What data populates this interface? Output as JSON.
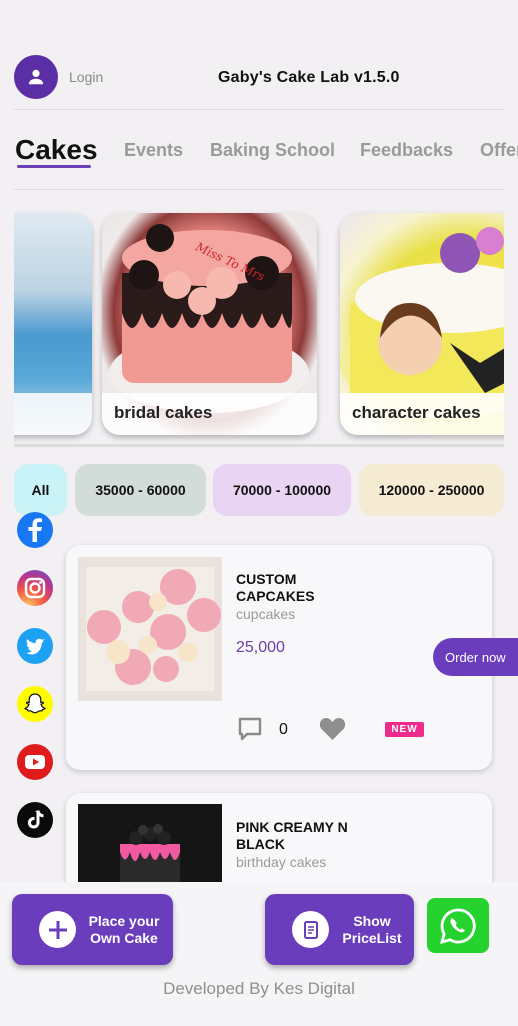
{
  "header": {
    "login_label": "Login",
    "app_title": "Gaby's Cake Lab v1.5.0"
  },
  "tabs": [
    {
      "label": "Cakes"
    },
    {
      "label": "Events"
    },
    {
      "label": "Baking School"
    },
    {
      "label": "Feedbacks"
    },
    {
      "label": "Offers"
    }
  ],
  "categories": [
    {
      "label": ""
    },
    {
      "label": "bridal cakes",
      "cake_text": "Miss To Mrs"
    },
    {
      "label": "character cakes"
    }
  ],
  "price_filters": [
    {
      "label": "All",
      "color": "#c9f3f6"
    },
    {
      "label": "35000 - 60000",
      "color": "#d2dcd8"
    },
    {
      "label": "70000 - 100000",
      "color": "#e9d4f3"
    },
    {
      "label": "120000 - 250000",
      "color": "#f4ebd2"
    }
  ],
  "social": [
    "facebook-icon",
    "instagram-icon",
    "twitter-icon",
    "snapchat-icon",
    "youtube-icon",
    "tiktok-icon"
  ],
  "products": [
    {
      "name": "CUSTOM CAPCAKES",
      "category": "cupcakes",
      "price": "25,000",
      "comments": "0",
      "badge": "NEW"
    },
    {
      "name": "PINK CREAMY N BLACK",
      "category": "birthday cakes"
    }
  ],
  "order_label": "Order now",
  "actions": {
    "place_order": "Place your Own Cake",
    "pricelist": "Show PriceList"
  },
  "footer": "Developed By Kes Digital",
  "colors": {
    "accent": "#6a3dbd",
    "whatsapp": "#25d22e",
    "badge": "#ec2b8c"
  }
}
